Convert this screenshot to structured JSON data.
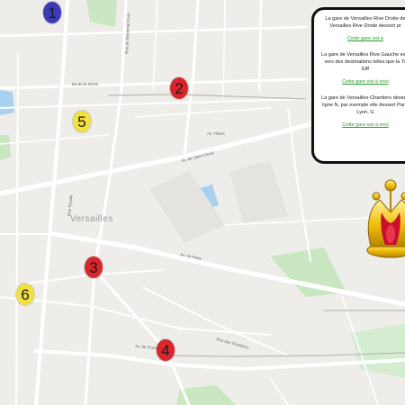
{
  "map": {
    "district_label": "Versailles",
    "road_labels": {
      "route_de_saint_cloud": "Av. de Saint-Cloud",
      "route_de_paris": "Av. de Paris",
      "route_de_sceaux": "Av. de Sceaux",
      "rue_royale": "Rue Royale",
      "bd_de_la_reine": "Bd de la Reine",
      "rue_foch": "Rue du Maréchal Foch",
      "av_thiers": "Av. Thiers",
      "rue_chantiers": "Rue des Chantiers"
    }
  },
  "markers": [
    {
      "number": "1",
      "color": "#3b3bb8"
    },
    {
      "number": "2",
      "color": "#d8262c"
    },
    {
      "number": "3",
      "color": "#d8262c"
    },
    {
      "number": "4",
      "color": "#d8262c"
    },
    {
      "number": "5",
      "color": "#f0e040"
    },
    {
      "number": "6",
      "color": "#f0e040"
    }
  ],
  "infobox": {
    "sections": [
      {
        "lines": [
          "La gare de Versailles Rive Droite de",
          "Versailles Rive Droite dessert pr"
        ],
        "link": "Cette gare est à"
      },
      {
        "lines": [
          "La gare de Versailles Rive Gauche est p",
          "vers des destinations telles que la To",
          "Eiff"
        ],
        "link": "Cette gare est à envi"
      },
      {
        "lines": [
          "La gare de Versailles-Chantiers dessert",
          "ligne N, par exemple elle dessert Paris",
          "Lyon, G"
        ],
        "link": "Cette gare est à envi"
      }
    ]
  },
  "crown_icon": "crown-icon",
  "colors": {
    "background": "#eeedea",
    "road": "#ffffff",
    "park": "#c9e8c1",
    "water": "#a9d0ef",
    "link": "#2a9d2a"
  }
}
